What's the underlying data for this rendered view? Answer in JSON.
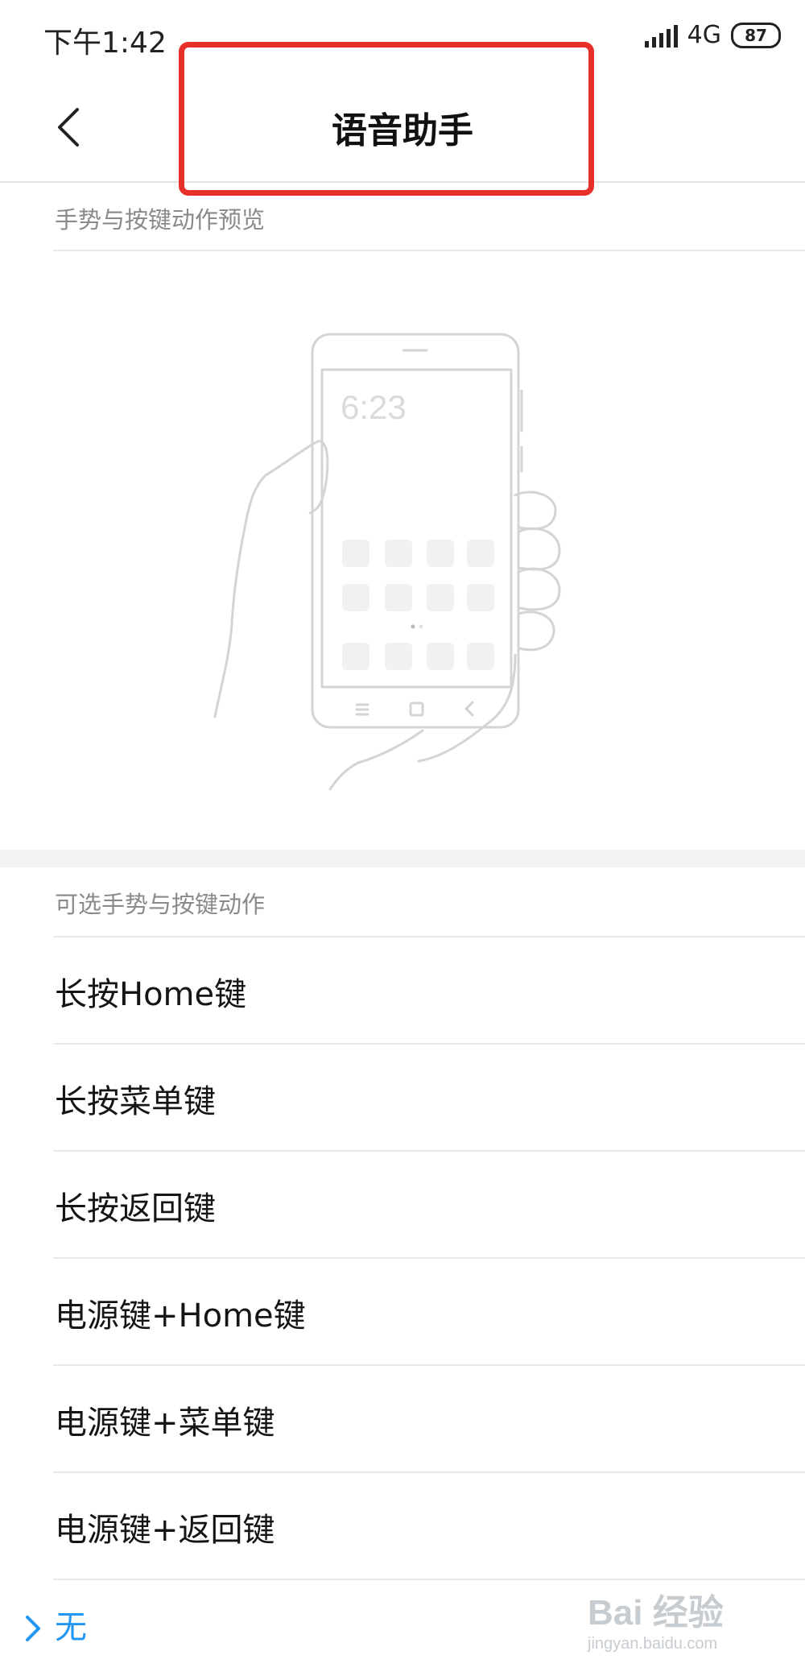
{
  "status_bar": {
    "time": "下午1:42",
    "network": "4G",
    "battery": "87"
  },
  "header": {
    "title": "语音助手",
    "back_icon": "chevron-left-icon"
  },
  "preview_section": {
    "header": "手势与按键动作预览",
    "phone_time": "6:23"
  },
  "options_section": {
    "header": "可选手势与按键动作",
    "items": [
      {
        "label": "长按Home键"
      },
      {
        "label": "长按菜单键"
      },
      {
        "label": "长按返回键"
      },
      {
        "label": "电源键+Home键"
      },
      {
        "label": "电源键+菜单键"
      },
      {
        "label": "电源键+返回键"
      }
    ],
    "selected": {
      "label": "无",
      "icon": "chevron-right-icon"
    }
  },
  "watermark": {
    "text": "Bai 经验",
    "url": "jingyan.baidu.com"
  },
  "colors": {
    "accent": "#2196f3",
    "highlight": "#e8302a"
  }
}
